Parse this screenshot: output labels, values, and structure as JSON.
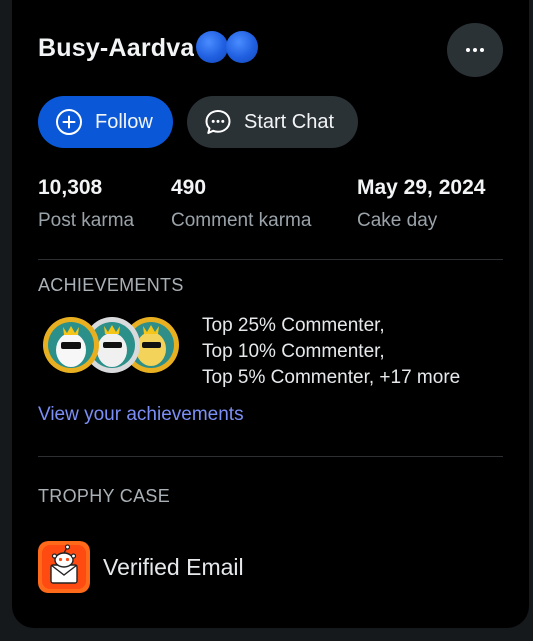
{
  "profile": {
    "username": "Busy-Aardva",
    "more_options_icon": "ellipsis-icon"
  },
  "actions": {
    "follow_label": "Follow",
    "follow_icon": "plus-circle-icon",
    "chat_label": "Start Chat",
    "chat_icon": "chat-bubble-icon",
    "follow_color": "#0a58d8",
    "secondary_color": "#2a3236"
  },
  "stats": [
    {
      "value": "10,308",
      "label": "Post karma"
    },
    {
      "value": "490",
      "label": "Comment karma"
    },
    {
      "value": "May 29, 2024",
      "label": "Cake day"
    }
  ],
  "achievements": {
    "title": "ACHIEVEMENTS",
    "lines": [
      "Top 25% Commenter,",
      "Top 10% Commenter,",
      "Top 5% Commenter, +17 more"
    ],
    "link": "View your achievements",
    "link_color": "#7b8ff5"
  },
  "trophy_case": {
    "title": "TROPHY CASE",
    "items": [
      {
        "name": "Verified Email",
        "icon": "verified-email-icon"
      }
    ]
  }
}
